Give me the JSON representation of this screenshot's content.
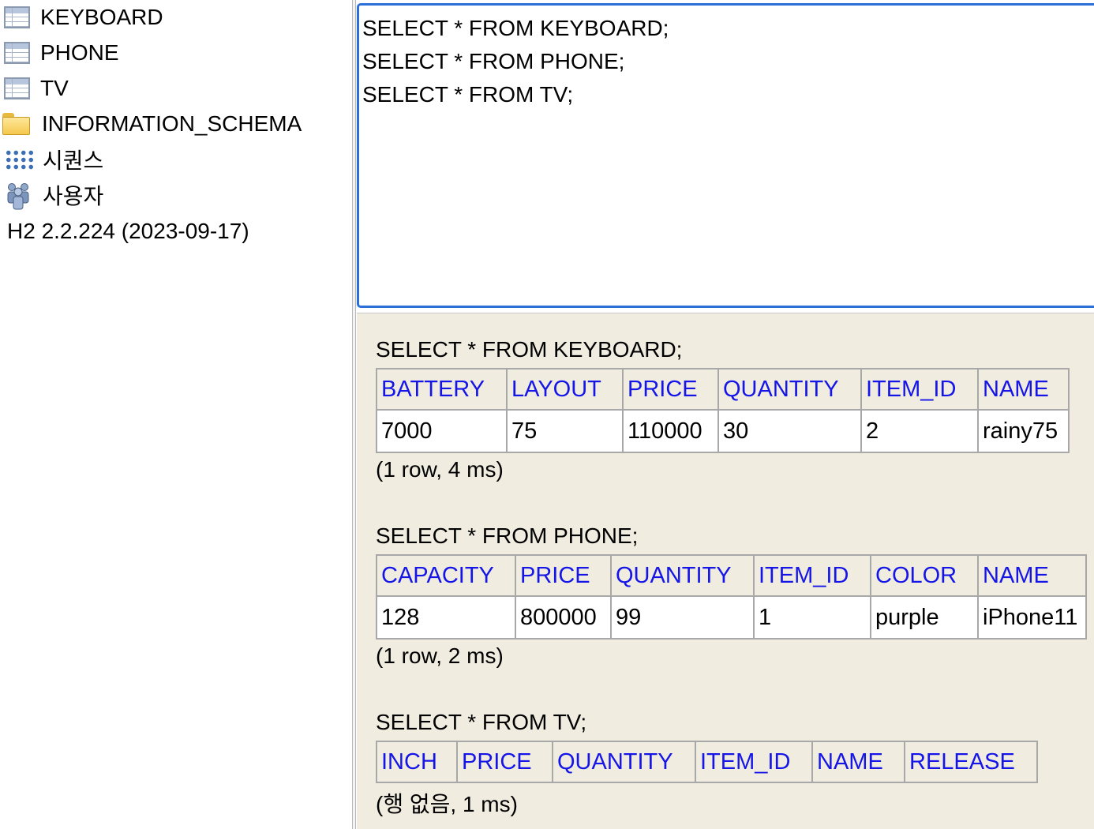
{
  "tree": {
    "items": [
      {
        "label": "KEYBOARD",
        "icon": "table-icon"
      },
      {
        "label": "PHONE",
        "icon": "table-icon"
      },
      {
        "label": "TV",
        "icon": "table-icon"
      },
      {
        "label": "INFORMATION_SCHEMA",
        "icon": "folder-icon"
      },
      {
        "label": "시퀀스",
        "icon": "sequence-icon"
      },
      {
        "label": "사용자",
        "icon": "users-icon"
      }
    ],
    "version": "H2 2.2.224 (2023-09-17)"
  },
  "editor": {
    "lines": [
      "SELECT * FROM KEYBOARD;",
      "SELECT * FROM PHONE;",
      "SELECT * FROM TV;"
    ]
  },
  "results": [
    {
      "query": "SELECT * FROM KEYBOARD;",
      "columns": [
        "BATTERY",
        "LAYOUT",
        "PRICE",
        "QUANTITY",
        "ITEM_ID",
        "NAME"
      ],
      "rows": [
        [
          "7000",
          "75",
          "110000",
          "30",
          "2",
          "rainy75"
        ]
      ],
      "status": "(1 row, 4 ms)"
    },
    {
      "query": "SELECT * FROM PHONE;",
      "columns": [
        "CAPACITY",
        "PRICE",
        "QUANTITY",
        "ITEM_ID",
        "COLOR",
        "NAME"
      ],
      "rows": [
        [
          "128",
          "800000",
          "99",
          "1",
          "purple",
          "iPhone11"
        ]
      ],
      "status": "(1 row, 2 ms)"
    },
    {
      "query": "SELECT * FROM TV;",
      "columns": [
        "INCH",
        "PRICE",
        "QUANTITY",
        "ITEM_ID",
        "NAME",
        "RELEASE"
      ],
      "rows": [],
      "status": "(행 없음, 1 ms)"
    }
  ],
  "colors": {
    "column_header": "#1515e8",
    "results_background": "#f0ede0",
    "editor_focus_border": "#2d6fd9"
  }
}
